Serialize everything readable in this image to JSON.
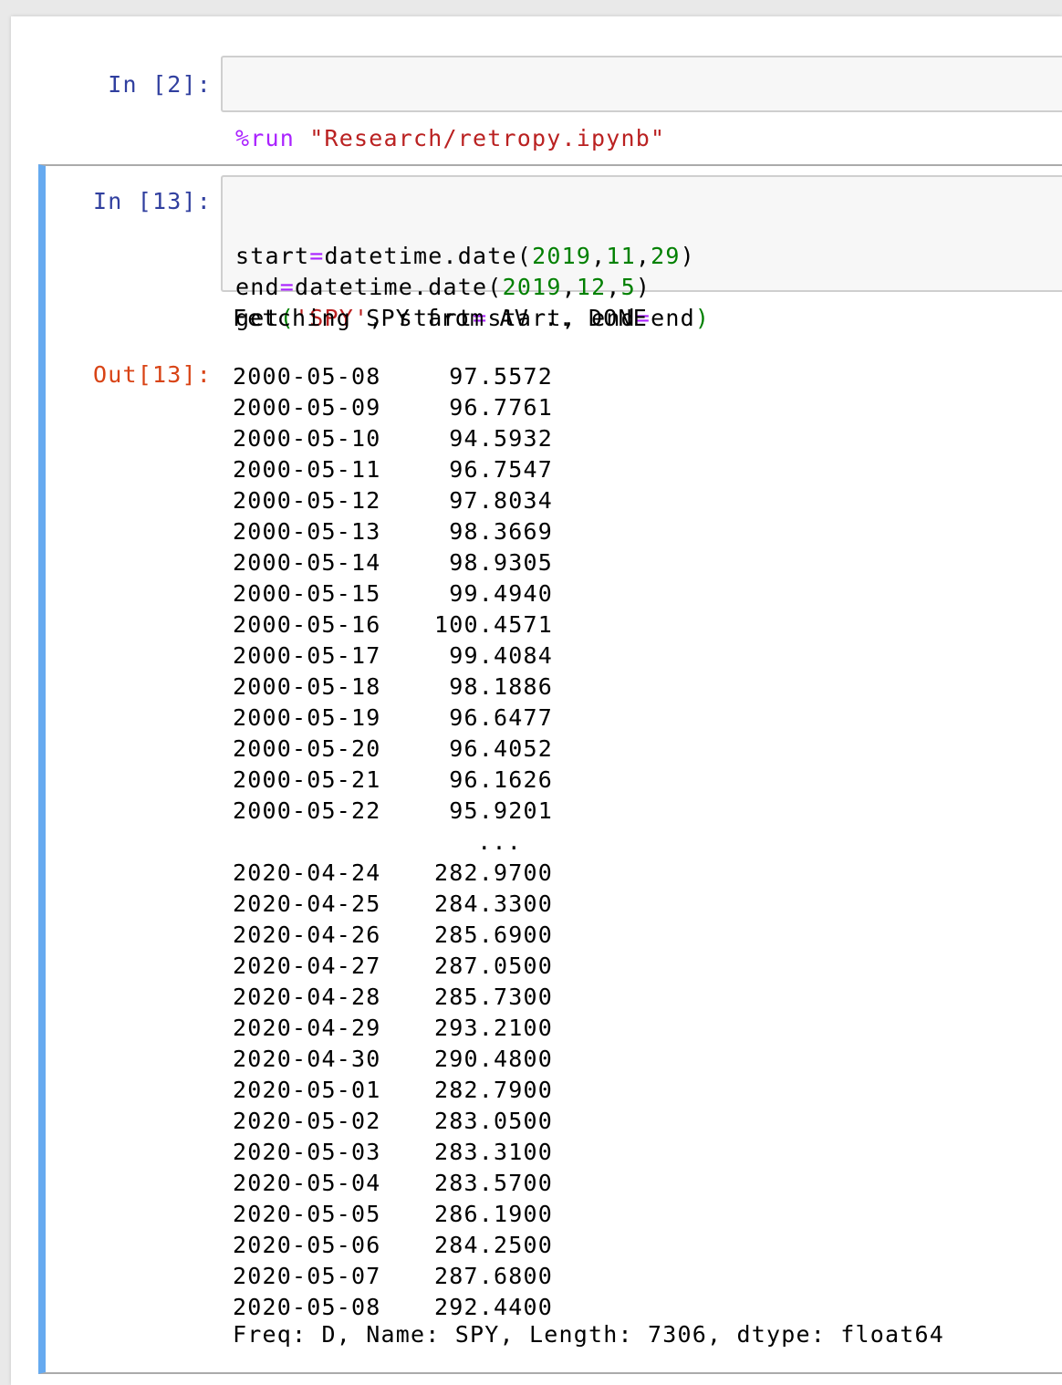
{
  "cells": [
    {
      "prompt": "In [2]:",
      "code": {
        "magic": "%run",
        "space": " ",
        "string": "\"Research/retropy.ipynb\""
      }
    },
    {
      "prompt": "In [13]:",
      "code_lines": [
        [
          {
            "t": "start",
            "c": "plain"
          },
          {
            "t": "=",
            "c": "op"
          },
          {
            "t": "datetime.date(",
            "c": "plain"
          },
          {
            "t": "2019",
            "c": "num"
          },
          {
            "t": ",",
            "c": "plain"
          },
          {
            "t": "11",
            "c": "num"
          },
          {
            "t": ",",
            "c": "plain"
          },
          {
            "t": "29",
            "c": "num"
          },
          {
            "t": ")",
            "c": "plain"
          }
        ],
        [
          {
            "t": "end",
            "c": "plain"
          },
          {
            "t": "=",
            "c": "op"
          },
          {
            "t": "datetime.date(",
            "c": "plain"
          },
          {
            "t": "2019",
            "c": "num"
          },
          {
            "t": ",",
            "c": "plain"
          },
          {
            "t": "12",
            "c": "num"
          },
          {
            "t": ",",
            "c": "plain"
          },
          {
            "t": "5",
            "c": "num"
          },
          {
            "t": ")",
            "c": "plain"
          }
        ],
        [
          {
            "t": "get",
            "c": "plain"
          },
          {
            "t": "(",
            "c": "num"
          },
          {
            "t": "'SPY'",
            "c": "str"
          },
          {
            "t": ", start",
            "c": "plain"
          },
          {
            "t": "=",
            "c": "op"
          },
          {
            "t": "start, end",
            "c": "plain"
          },
          {
            "t": "=",
            "c": "op"
          },
          {
            "t": "end",
            "c": "plain"
          },
          {
            "t": ")",
            "c": "num"
          }
        ]
      ],
      "stream_output": "Fetching SPY from AV .. DONE",
      "out_prompt": "Out[13]:",
      "series_head": [
        [
          "2000-05-08",
          "97.5572"
        ],
        [
          "2000-05-09",
          "96.7761"
        ],
        [
          "2000-05-10",
          "94.5932"
        ],
        [
          "2000-05-11",
          "96.7547"
        ],
        [
          "2000-05-12",
          "97.8034"
        ],
        [
          "2000-05-13",
          "98.3669"
        ],
        [
          "2000-05-14",
          "98.9305"
        ],
        [
          "2000-05-15",
          "99.4940"
        ],
        [
          "2000-05-16",
          "100.4571"
        ],
        [
          "2000-05-17",
          "99.4084"
        ],
        [
          "2000-05-18",
          "98.1886"
        ],
        [
          "2000-05-19",
          "96.6477"
        ],
        [
          "2000-05-20",
          "96.4052"
        ],
        [
          "2000-05-21",
          "96.1626"
        ],
        [
          "2000-05-22",
          "95.9201"
        ]
      ],
      "ellipsis": "...",
      "series_tail": [
        [
          "2020-04-24",
          "282.9700"
        ],
        [
          "2020-04-25",
          "284.3300"
        ],
        [
          "2020-04-26",
          "285.6900"
        ],
        [
          "2020-04-27",
          "287.0500"
        ],
        [
          "2020-04-28",
          "285.7300"
        ],
        [
          "2020-04-29",
          "293.2100"
        ],
        [
          "2020-04-30",
          "290.4800"
        ],
        [
          "2020-05-01",
          "282.7900"
        ],
        [
          "2020-05-02",
          "283.0500"
        ],
        [
          "2020-05-03",
          "283.3100"
        ],
        [
          "2020-05-04",
          "283.5700"
        ],
        [
          "2020-05-05",
          "286.1900"
        ],
        [
          "2020-05-06",
          "284.2500"
        ],
        [
          "2020-05-07",
          "287.6800"
        ],
        [
          "2020-05-08",
          "292.4400"
        ]
      ],
      "footer": "Freq: D, Name: SPY, Length: 7306, dtype: float64"
    }
  ],
  "colors": {
    "prompt_in": "#303f9f",
    "prompt_out": "#d84315",
    "selected_bar": "#66aaf0",
    "magic": "#aa22ff",
    "string": "#ba2121",
    "number": "#008000"
  }
}
